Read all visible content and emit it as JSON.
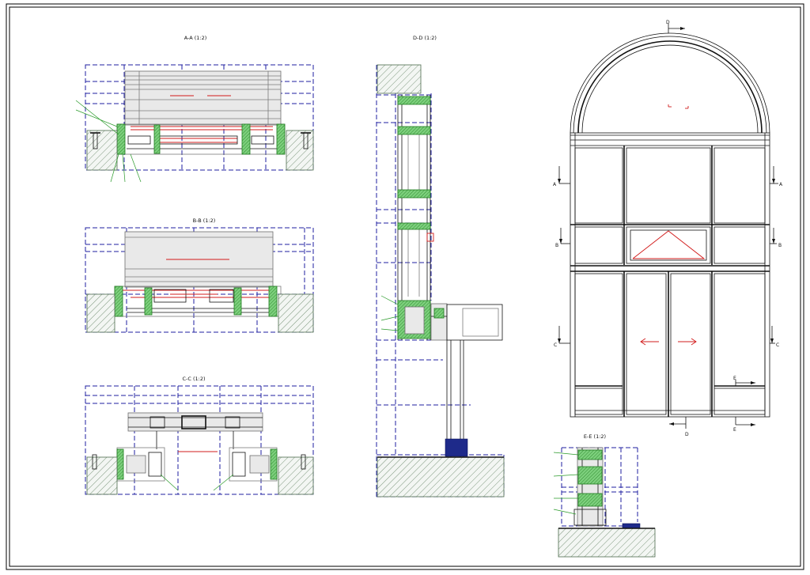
{
  "drawing": {
    "sections": {
      "a": {
        "title": "A-A (1:2)"
      },
      "b": {
        "title": "B-B (1:2)"
      },
      "c": {
        "title": "C-C (1:2)"
      },
      "d": {
        "title": "D-D (1:2)"
      },
      "e": {
        "title": "E-E (1:2)"
      }
    },
    "markers": {
      "a_left": "A",
      "a_right": "A",
      "b_left": "B",
      "b_right": "B",
      "c_left": "C",
      "c_right": "C",
      "d_top": "D",
      "d_bottom": "D",
      "e_top": "E",
      "e_bottom": "E"
    },
    "colors": {
      "outline": "#111111",
      "grid_dashed": "#1f1fa0",
      "cut_profile": "#2a9a2a",
      "annotation": "#d21c1c",
      "ground_hatch": "#4d6b4d"
    }
  }
}
